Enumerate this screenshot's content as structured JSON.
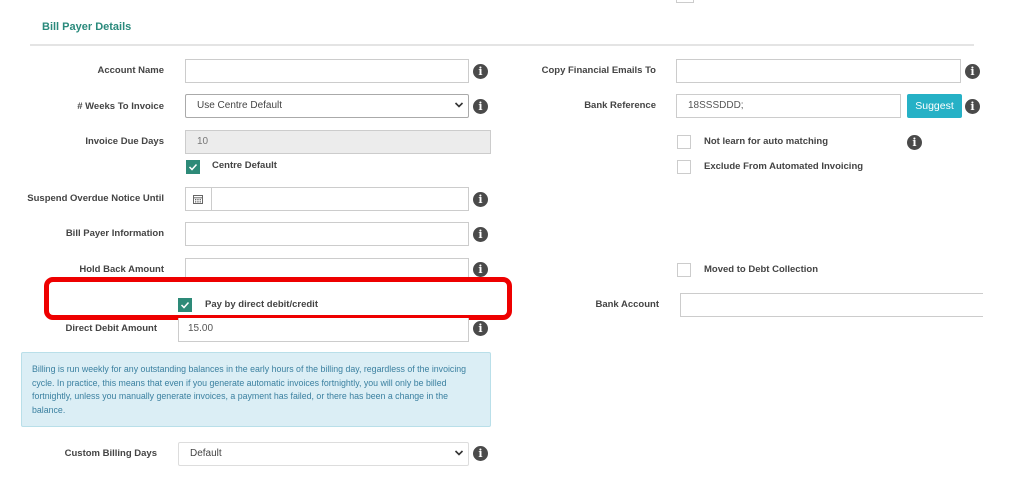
{
  "section": {
    "title": "Bill Payer Details"
  },
  "left": {
    "account_name": {
      "label": "Account Name",
      "value": ""
    },
    "weeks_to_invoice": {
      "label": "# Weeks To Invoice",
      "value": "Use Centre Default"
    },
    "invoice_due_days": {
      "label": "Invoice Due Days",
      "value": "10"
    },
    "centre_default": {
      "label": "Centre Default",
      "checked": true
    },
    "suspend_overdue": {
      "label": "Suspend Overdue Notice Until",
      "value": ""
    },
    "bill_payer_info": {
      "label": "Bill Payer Information",
      "value": ""
    },
    "hold_back_amount": {
      "label": "Hold Back Amount",
      "value": ""
    },
    "pay_direct_debit": {
      "label": "Pay by direct debit/credit",
      "checked": true
    },
    "direct_debit_amount": {
      "label": "Direct Debit Amount",
      "value": "15.00"
    },
    "notice": "Billing is run weekly for any outstanding balances in the early hours of the billing day, regardless of the invoicing cycle. In practice, this means that even if you generate automatic invoices fortnightly, you will only be billed fortnightly, unless you manually generate invoices, a payment has failed, or there has been a change in the balance.",
    "custom_billing_days": {
      "label": "Custom Billing Days",
      "value": "Default"
    }
  },
  "right": {
    "copy_emails": {
      "label": "Copy Financial Emails To",
      "value": ""
    },
    "bank_reference": {
      "label": "Bank Reference",
      "value": "18SSSDDD;"
    },
    "suggest_label": "Suggest",
    "not_learn": {
      "label": "Not learn for auto matching",
      "checked": false
    },
    "exclude_invoicing": {
      "label": "Exclude From Automated Invoicing",
      "checked": false
    },
    "moved_debt": {
      "label": "Moved to Debt Collection",
      "checked": false
    },
    "bank_account": {
      "label": "Bank Account",
      "value": ""
    }
  },
  "icons": {
    "info": "info-circle-icon",
    "calendar": "calendar-icon",
    "check": "check-icon",
    "chevron": "chevron-down-icon"
  },
  "colors": {
    "accent": "#2a8a7c",
    "checkbox": "#2d8a78",
    "suggest": "#26b1c6",
    "notice_bg": "#dbeef5",
    "highlight": "#ee0000"
  }
}
